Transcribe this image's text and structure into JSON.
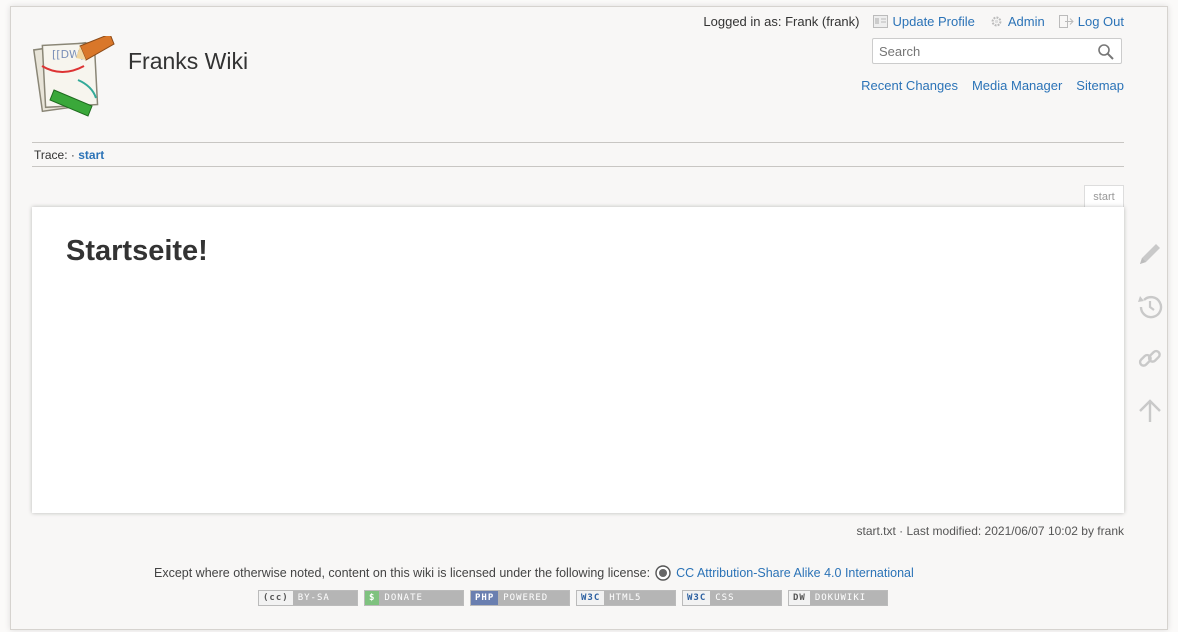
{
  "site": {
    "title": "Franks Wiki"
  },
  "user": {
    "logged_in_label": "Logged in as: Frank (frank)",
    "update_profile": "Update Profile",
    "admin": "Admin",
    "logout": "Log Out"
  },
  "search": {
    "placeholder": "Search",
    "value": ""
  },
  "site_tools": [
    "Recent Changes",
    "Media Manager",
    "Sitemap"
  ],
  "trace": {
    "label": "Trace: ·",
    "current": "start"
  },
  "page": {
    "tab": "start",
    "heading": "Startseite!"
  },
  "docinfo": "start.txt · Last modified: 2021/06/07 10:02 by frank",
  "license": {
    "text": "Except where otherwise noted, content on this wiki is licensed under the following license:",
    "link": "CC Attribution-Share Alike 4.0 International"
  },
  "badges": [
    {
      "left": "(cc)",
      "right": "BY-SA"
    },
    {
      "left": "$",
      "right": "DONATE"
    },
    {
      "left": "PHP",
      "right": "POWERED"
    },
    {
      "left": "W3C",
      "right": "HTML5"
    },
    {
      "left": "W3C",
      "right": "CSS"
    },
    {
      "left": "DW",
      "right": "DOKUWIKI"
    }
  ],
  "icons": {
    "page_tools": [
      "edit-icon",
      "revisions-icon",
      "backlinks-icon",
      "back-to-top-icon"
    ]
  },
  "colors": {
    "link": "#2b73b7",
    "page_bg": "#f8f7f6",
    "content_bg": "#ffffff"
  }
}
